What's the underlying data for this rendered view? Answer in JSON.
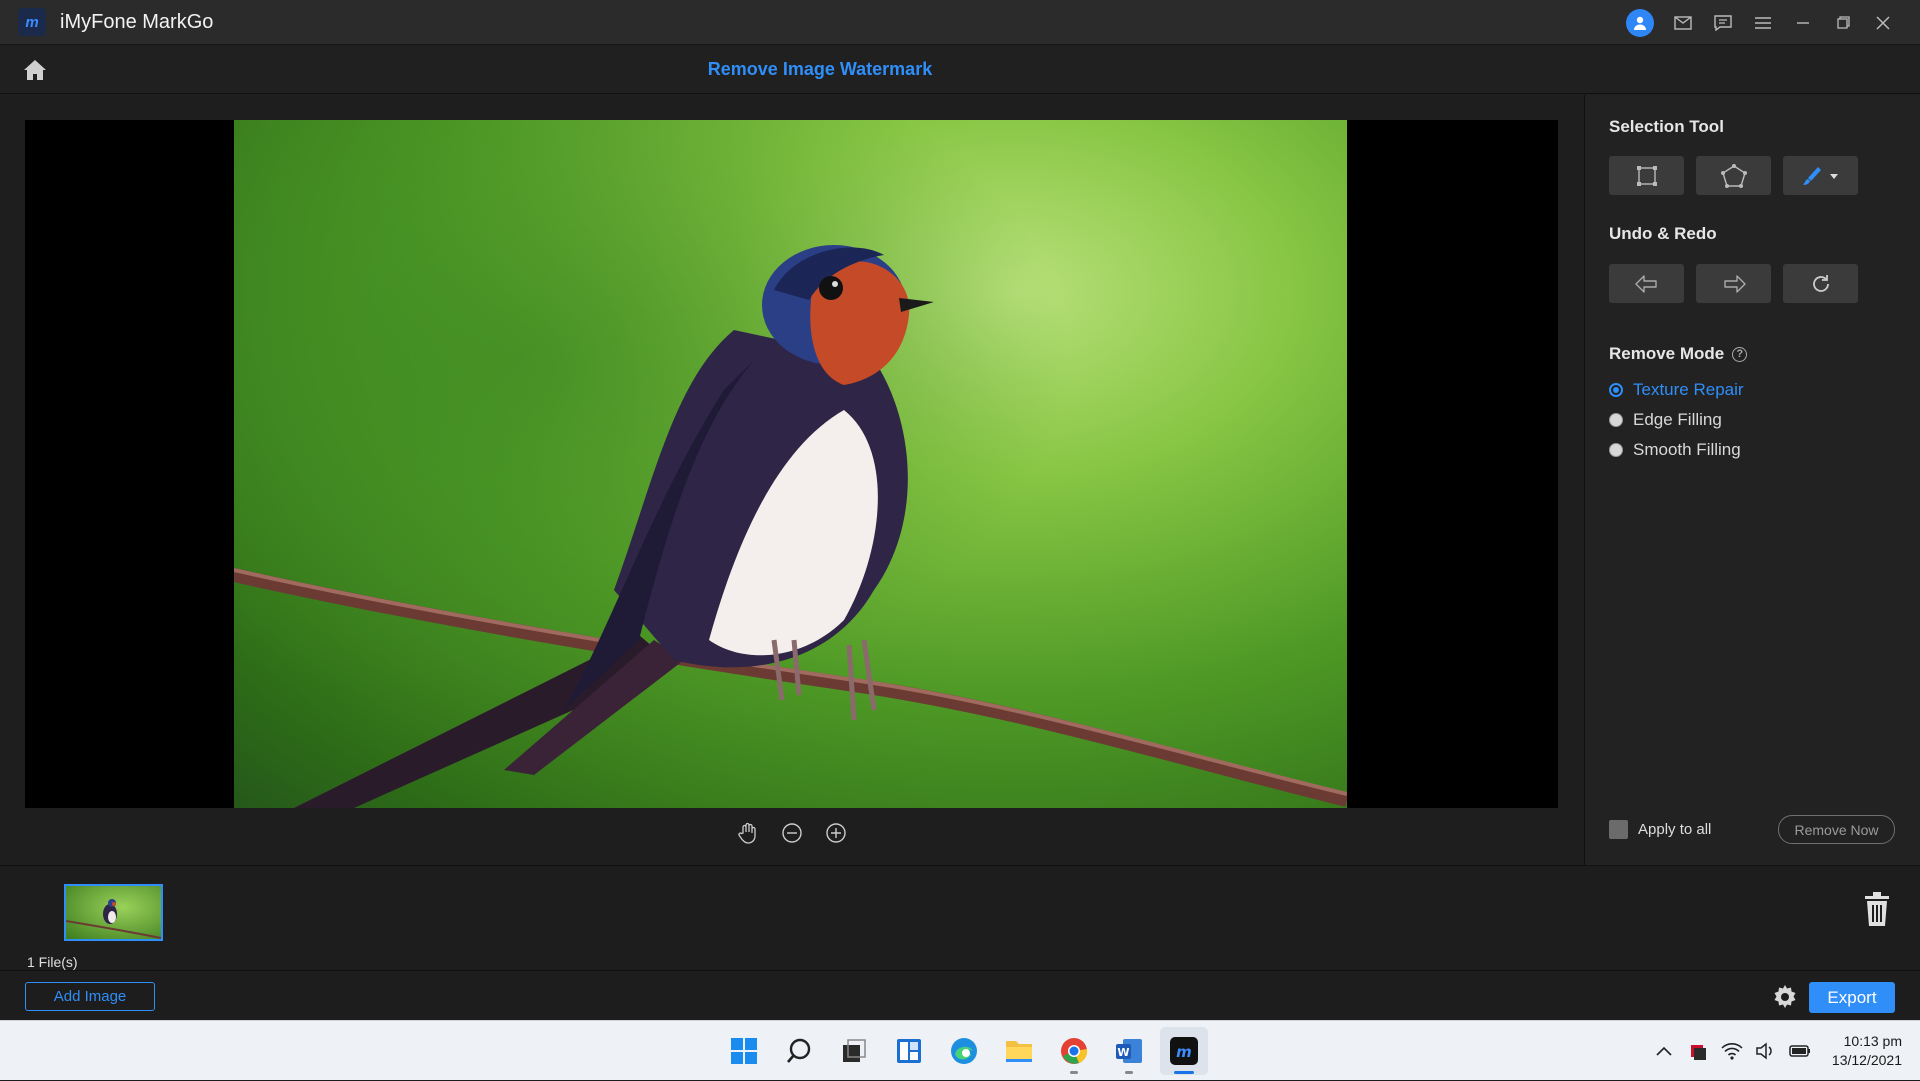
{
  "window": {
    "app_title": "iMyFone MarkGo",
    "logo_text": "m"
  },
  "header": {
    "page_title": "Remove Image Watermark"
  },
  "right_panel": {
    "selection_tool_title": "Selection Tool",
    "undo_redo_title": "Undo & Redo",
    "remove_mode_title": "Remove Mode",
    "help_glyph": "?",
    "modes": [
      {
        "label": "Texture Repair",
        "selected": true
      },
      {
        "label": "Edge Filling",
        "selected": false
      },
      {
        "label": "Smooth Filling",
        "selected": false
      }
    ],
    "apply_to_all_label": "Apply to all",
    "remove_now_label": "Remove Now"
  },
  "files": {
    "count_label": "1 File(s)"
  },
  "bottom": {
    "add_image_label": "Add Image",
    "export_label": "Export"
  },
  "taskbar": {
    "time": "10:13 pm",
    "date": "13/12/2021",
    "word_letter": "W",
    "markgo_letter": "m"
  },
  "colors": {
    "accent": "#2f8ef8",
    "title_bar": "#2b2b2b",
    "panel": "#222222"
  }
}
